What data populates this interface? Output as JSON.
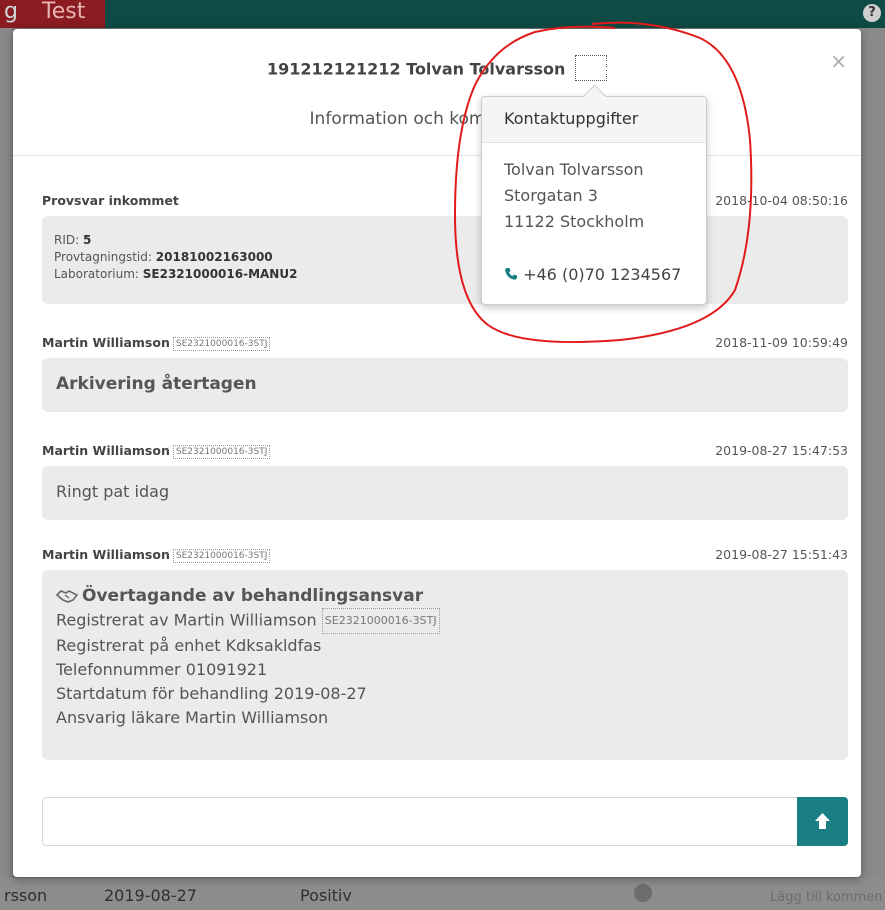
{
  "background": {
    "env_label": "Test",
    "leading_letter": "g",
    "help_icon": "?",
    "row": {
      "name": "rsson",
      "date": "2019-08-27",
      "result": "Positiv",
      "action": "Lägg till kommen"
    }
  },
  "modal": {
    "title": "191212121212 Tolvan Tolvarsson",
    "contact_icon": "contact-card-icon",
    "close_label": "×",
    "subtitle": "Information och kommentarer",
    "messages": [
      {
        "author": "Provsvar inkommet",
        "time": "2018-10-04 08:50:16",
        "lines": [
          {
            "label": "RID:",
            "value": "5"
          },
          {
            "label": "Provtagningstid:",
            "value": "20181002163000"
          },
          {
            "label": "Laboratorium:",
            "value": "SE2321000016-MANU2"
          }
        ]
      },
      {
        "author": "Martin Williamson",
        "code": "SE2321000016-3STJ",
        "time": "2018-11-09 10:59:49",
        "text": "Arkivering återtagen"
      },
      {
        "author": "Martin Williamson",
        "code": "SE2321000016-3STJ",
        "time": "2019-08-27 15:47:53",
        "text": "Ringt pat idag"
      },
      {
        "author": "Martin Williamson",
        "code": "SE2321000016-3STJ",
        "time": "2019-08-27 15:51:43",
        "headline": "Övertagande av behandlingsansvar",
        "lines": [
          "Registrerat av Martin Williamson",
          "Registrerat på enhet Kdksakldfas",
          "Telefonnummer 01091921",
          "Startdatum för behandling 2019-08-27",
          "Ansvarig läkare Martin Williamson"
        ],
        "registered_by_code": "SE2321000016-3STJ"
      }
    ],
    "composer": {
      "placeholder": ""
    },
    "send_icon": "arrow-up-icon"
  },
  "popover": {
    "title": "Kontaktuppgifter",
    "name": "Tolvan Tolvarsson",
    "street": "Storgatan 3",
    "city": "11122 Stockholm",
    "phone": "+46 (0)70 1234567"
  },
  "colors": {
    "accent": "#1a7f83",
    "annotation": "#e21a1a",
    "test_badge": "#8b1c22",
    "topbar": "#0f4a45"
  }
}
